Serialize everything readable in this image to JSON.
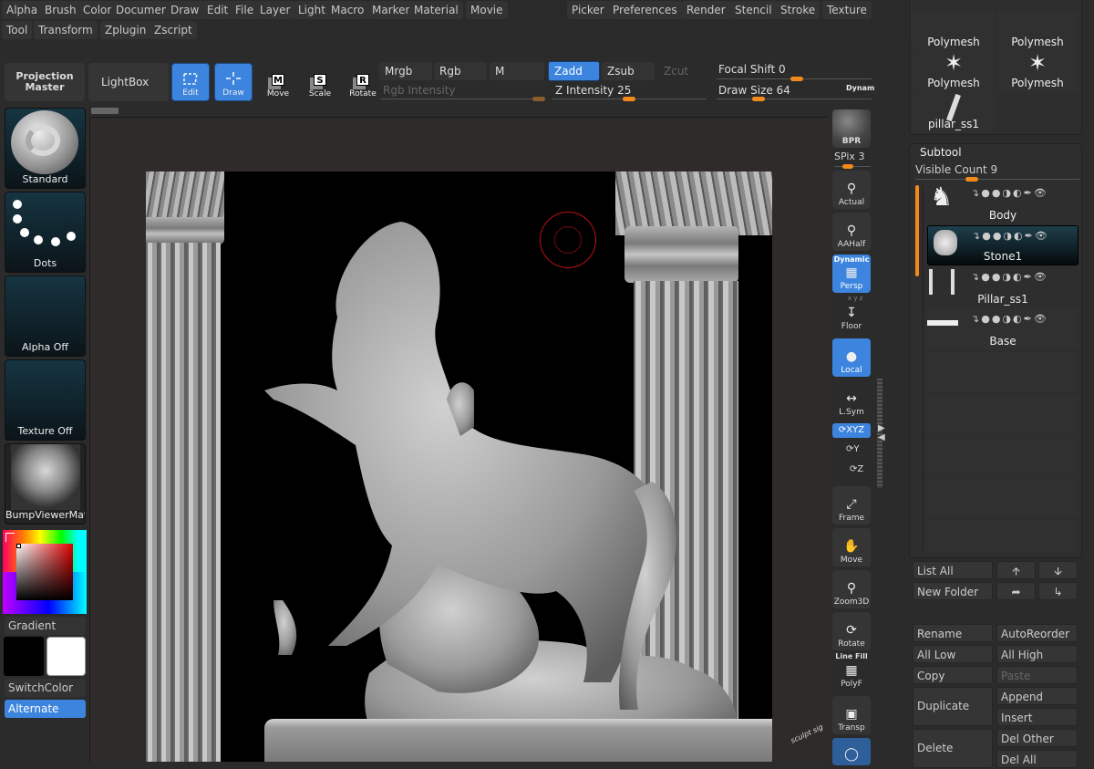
{
  "menubar": {
    "row1": [
      "Alpha",
      "Brush",
      "Color",
      "Document",
      "Draw",
      "Edit",
      "File",
      "Layer",
      "Light",
      "Macro",
      "Marker",
      "Material",
      "Movie",
      "Picker",
      "Preferences",
      "Render",
      "Stencil",
      "Stroke",
      "Texture"
    ],
    "row2": [
      "Tool",
      "Transform",
      "Zplugin",
      "Zscript"
    ]
  },
  "toolbar": {
    "projection_master": "Projection Master",
    "lightbox": "LightBox",
    "modes": [
      {
        "label": "Edit",
        "icon": "edit-icon",
        "active": true
      },
      {
        "label": "Draw",
        "icon": "draw-icon",
        "active": true
      },
      {
        "label": "Move",
        "icon": "move-icon",
        "key": "M",
        "active": false
      },
      {
        "label": "Scale",
        "icon": "scale-icon",
        "key": "S",
        "active": false
      },
      {
        "label": "Rotate",
        "icon": "rotate-icon",
        "key": "R",
        "active": false
      }
    ],
    "mrgb": "Mrgb",
    "rgb": "Rgb",
    "m": "M",
    "zadd": "Zadd",
    "zsub": "Zsub",
    "zcut": "Zcut",
    "rgb_intensity": "Rgb Intensity",
    "z_intensity_label": "Z Intensity",
    "z_intensity": 25,
    "focal_shift_label": "Focal Shift",
    "focal_shift": 0,
    "draw_size_label": "Draw Size",
    "draw_size": 64,
    "dynamic": "Dynam"
  },
  "left_panel": {
    "brush": "Standard",
    "stroke": "Dots",
    "alpha": "Alpha Off",
    "texture": "Texture Off",
    "material": "BumpViewerMat",
    "gradient": "Gradient",
    "switch_color": "SwitchColor",
    "alternate": "Alternate",
    "main_color": "#000000",
    "secondary_color": "#ffffff"
  },
  "right_tools": {
    "bpr": "BPR",
    "spix_label": "SPix",
    "spix": 3,
    "actual": "Actual",
    "aahalf": "AAHalf",
    "dynamic_label": "Dynamic",
    "persp": "Persp",
    "axes": "x y z",
    "floor": "Floor",
    "local": "Local",
    "lsym": "L.Sym",
    "xyz": "XYZ",
    "y": "Y",
    "z": "Z",
    "frame": "Frame",
    "move": "Move",
    "zoom3d": "Zoom3D",
    "rotate": "Rotate",
    "line_fill": "Line Fill",
    "polyf": "PolyF",
    "transp": "Transp"
  },
  "tool_palette": {
    "items": [
      "Polymesh",
      "Polymesh",
      "Polymesh",
      "Polymesh",
      "pillar_ss1"
    ]
  },
  "subtool": {
    "title": "Subtool",
    "visible_count_label": "Visible Count",
    "visible_count": 9,
    "items": [
      {
        "name": "Body",
        "selected": false
      },
      {
        "name": "Stone1",
        "selected": true
      },
      {
        "name": "Pillar_ss1",
        "selected": false
      },
      {
        "name": "Base",
        "selected": false
      }
    ],
    "buttons": {
      "list_all": "List All",
      "new_folder": "New Folder",
      "rename": "Rename",
      "auto_reorder": "AutoReorder",
      "all_low": "All Low",
      "all_high": "All High",
      "copy": "Copy",
      "paste": "Paste",
      "duplicate": "Duplicate",
      "append": "Append",
      "insert": "Insert",
      "delete": "Delete",
      "del_other": "Del Other",
      "del_all": "Del All"
    }
  },
  "canvas": {
    "signature": "sculpt sig"
  },
  "colors": {
    "accent": "#3c84de",
    "slider": "#f28a1a",
    "cursor": "#c0101a"
  }
}
